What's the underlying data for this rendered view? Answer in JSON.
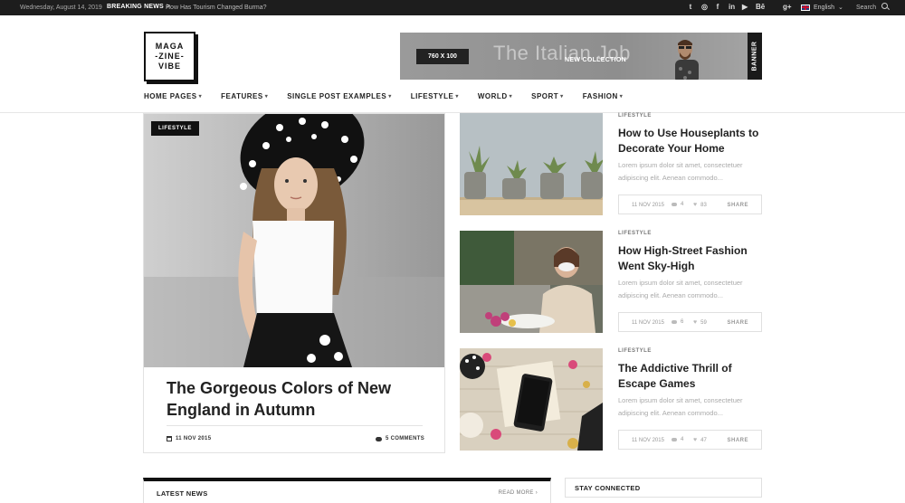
{
  "topbar": {
    "date": "Wednesday, August 14, 2019",
    "breaking_label": "BREAKING NEWS",
    "breaking_arrow": ">",
    "breaking_text": "How Has Tourism Changed Burma?",
    "social": [
      "twitter",
      "instagram",
      "facebook",
      "linkedin",
      "youtube",
      "behance",
      "apple",
      "google-plus"
    ],
    "social_glyphs": [
      "t",
      "◎",
      "f",
      "in",
      "▶",
      "Bē",
      "",
      "g+"
    ],
    "language": "English",
    "search_label": "Search"
  },
  "logo": {
    "lines": [
      "MAGA",
      "-ZINE-",
      "VIBE"
    ]
  },
  "banner": {
    "size": "760 X 100",
    "title": "The Italian Job",
    "subtitle": "NEW COLLECTION",
    "tag": "BANNER"
  },
  "nav": {
    "items": [
      {
        "label": "HOME PAGES"
      },
      {
        "label": "FEATURES"
      },
      {
        "label": "SINGLE POST EXAMPLES"
      },
      {
        "label": "LIFESTYLE"
      },
      {
        "label": "WORLD"
      },
      {
        "label": "SPORT"
      },
      {
        "label": "FASHION"
      }
    ]
  },
  "hero": {
    "category": "LIFESTYLE",
    "title": "The Gorgeous Colors of New England in Autumn",
    "date": "11 NOV 2015",
    "comments": "5 COMMENTS"
  },
  "articles": [
    {
      "category": "LIFESTYLE",
      "title": "How to Use Houseplants to Decorate Your Home",
      "excerpt": "Lorem ipsum dolor sit amet, consectetuer adipiscing elit. Aenean commodo...",
      "date": "11 NOV 2015",
      "comments": "4",
      "likes": "83",
      "share": "SHARE"
    },
    {
      "category": "LIFESTYLE",
      "title": "How High-Street Fashion Went Sky-High",
      "excerpt": "Lorem ipsum dolor sit amet, consectetuer adipiscing elit. Aenean commodo...",
      "date": "11 NOV 2015",
      "comments": "6",
      "likes": "59",
      "share": "SHARE"
    },
    {
      "category": "LIFESTYLE",
      "title": "The Addictive Thrill of Escape Games",
      "excerpt": "Lorem ipsum dolor sit amet, consectetuer adipiscing elit. Aenean commodo...",
      "date": "11 NOV 2015",
      "comments": "4",
      "likes": "47",
      "share": "SHARE"
    }
  ],
  "latest": {
    "title": "LATEST NEWS",
    "read_more": "READ MORE",
    "read_more_arrow": "›"
  },
  "stay": {
    "title": "STAY CONNECTED"
  }
}
